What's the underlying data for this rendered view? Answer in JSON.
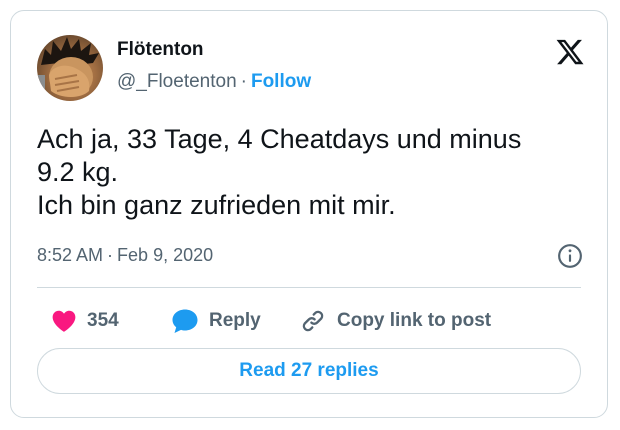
{
  "tweet": {
    "author": {
      "display_name": "Flötenton",
      "handle": "@_Floetenton",
      "separator": "·",
      "follow_label": "Follow"
    },
    "text_lines": [
      "Ach ja, 33 Tage, 4 Cheatdays und minus",
      "9.2 kg.",
      "Ich bin ganz zufrieden mit mir."
    ],
    "time": "8:52 AM",
    "time_separator": "·",
    "date": "Feb 9, 2020",
    "actions": {
      "like_count": "354",
      "reply_label": "Reply",
      "copy_label": "Copy link to post"
    },
    "read_replies_label": "Read 27 replies"
  },
  "icons": {
    "logo": "x-logo-icon",
    "info": "info-icon",
    "like": "heart-icon",
    "reply": "speech-bubble-icon",
    "copy": "link-icon"
  },
  "colors": {
    "text_primary": "#0f1419",
    "text_secondary": "#536471",
    "accent_blue": "#1d9bf0",
    "like_pink": "#f91880",
    "border": "#cfd9de"
  }
}
